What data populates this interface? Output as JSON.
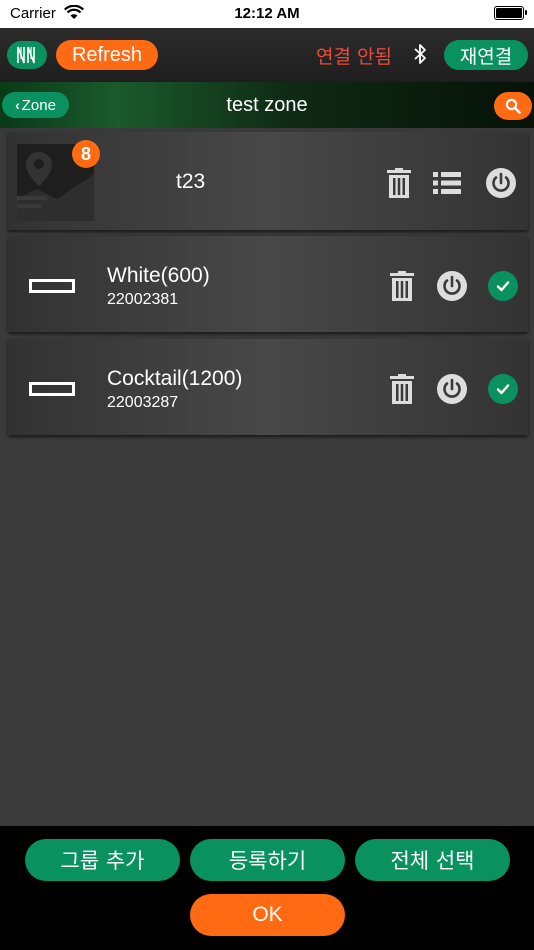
{
  "status_bar": {
    "carrier": "Carrier",
    "time": "12:12 AM"
  },
  "toolbar": {
    "logo_icon": "nn-logo-icon",
    "refresh_label": "Refresh",
    "connection_status": "연결 안됨",
    "bluetooth_icon": "bluetooth-icon",
    "reconnect_label": "재연결"
  },
  "zone": {
    "back_label": "Zone",
    "title": "test zone",
    "search_icon": "search-icon"
  },
  "group": {
    "name": "t23",
    "count": "8"
  },
  "devices": [
    {
      "name": "White(600)",
      "serial": "22002381"
    },
    {
      "name": "Cocktail(1200)",
      "serial": "22003287"
    }
  ],
  "bottom": {
    "add_group": "그룹 추가",
    "register": "등록하기",
    "select_all": "전체 선택",
    "ok": "OK"
  },
  "colors": {
    "accent_green": "#0a9160",
    "accent_orange": "#ff6a13",
    "status_red": "#f04a3a"
  }
}
